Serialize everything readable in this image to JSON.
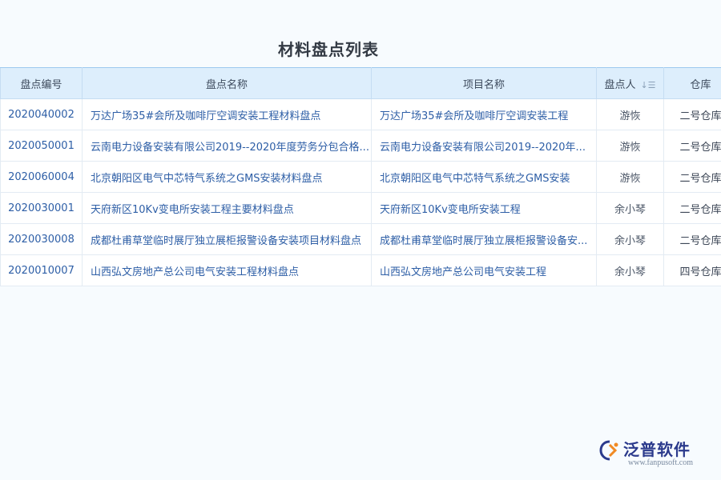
{
  "page": {
    "title": "材料盘点列表"
  },
  "table": {
    "headers": {
      "code": "盘点编号",
      "name": "盘点名称",
      "project": "项目名称",
      "person": "盘点人",
      "warehouse": "仓库"
    },
    "rows": [
      {
        "code": "2020040002",
        "name": "万达广场35#会所及咖啡厅空调安装工程材料盘点",
        "project": "万达广场35#会所及咖啡厅空调安装工程",
        "person": "游恢",
        "warehouse": "二号仓库"
      },
      {
        "code": "2020050001",
        "name": "云南电力设备安装有限公司2019--2020年度劳务分包合格...",
        "project": "云南电力设备安装有限公司2019--2020年...",
        "person": "游恢",
        "warehouse": "二号仓库"
      },
      {
        "code": "2020060004",
        "name": "北京朝阳区电气中芯特气系统之GMS安装材料盘点",
        "project": "北京朝阳区电气中芯特气系统之GMS安装",
        "person": "游恢",
        "warehouse": "二号仓库"
      },
      {
        "code": "2020030001",
        "name": "天府新区10Kv变电所安装工程主要材料盘点",
        "project": "天府新区10Kv变电所安装工程",
        "person": "余小琴",
        "warehouse": "二号仓库"
      },
      {
        "code": "2020030008",
        "name": "成都杜甫草堂临时展厅独立展柜报警设备安装项目材料盘点",
        "project": "成都杜甫草堂临时展厅独立展柜报警设备安...",
        "person": "余小琴",
        "warehouse": "二号仓库"
      },
      {
        "code": "2020010007",
        "name": "山西弘文房地产总公司电气安装工程材料盘点",
        "project": "山西弘文房地产总公司电气安装工程",
        "person": "余小琴",
        "warehouse": "四号仓库"
      }
    ]
  },
  "logo": {
    "text": "泛普软件",
    "url": "www.fanpusoft.com"
  },
  "icons": {
    "sort": "sort-descending-icon",
    "logo": "fanpu-logo-mark"
  },
  "colors": {
    "header_bg": "#ddeefc",
    "link": "#2d5ea6",
    "logo": "#2b3a8c",
    "logo_accent": "#f08a24"
  }
}
